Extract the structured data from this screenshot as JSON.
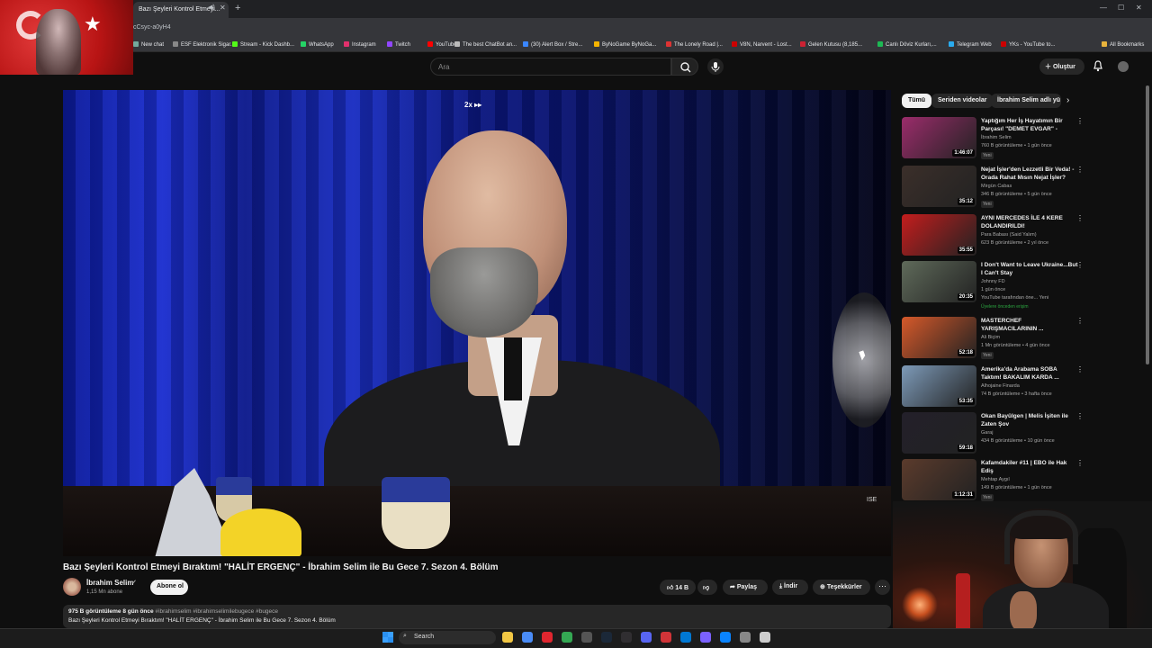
{
  "browser": {
    "active_tab_title": "Bazı Şeyleri Kontrol Etmeyi...",
    "url_fragment": "cCsyc-a0yH4",
    "bookmarks": [
      "New chat",
      "ESF Elektronik Sigar...",
      "Stream - Kick Dashb...",
      "WhatsApp",
      "Instagram",
      "Twitch",
      "YouTube",
      "The best ChatBot an...",
      "(30) Alert Box / Stre...",
      "ByNoGame ByNoGa...",
      "The Lonely Road |...",
      "V8N, Narvent - Lost...",
      "Gelen Kutusu (8,185...",
      "Canlı Döviz Kurları,...",
      "Telegram Web",
      "YKs - YouTube to..."
    ],
    "all_bookmarks_label": "All Bookmarks"
  },
  "youtube_header": {
    "search_placeholder": "Ara",
    "create_label": "Oluştur"
  },
  "video": {
    "speed_badge": "2x ▸▸",
    "watermark": "ISE",
    "title": "Bazı Şeyleri Kontrol Etmeyi Bıraktım! \"HALİT ERGENÇ\" - İbrahim Selim ile Bu Gece 7. Sezon 4. Bölüm",
    "channel": {
      "name": "İbrahim Selim",
      "subscribers": "1,15 Mn abone",
      "subscribe_label": "Abone ol"
    },
    "actions": {
      "likes": "14 B",
      "share": "Paylaş",
      "download": "İndir",
      "thanks": "Teşekkürler"
    },
    "description": {
      "views": "975 B görüntüleme",
      "age": "8 gün önce",
      "hashtags": "#ibrahimselim #ibrahimselimilebugece #bugece",
      "text": "Bazı Şeyleri Kontrol Etmeyi Bıraktım! \"HALİT ERGENÇ\" - İbrahim Selim ile Bu Gece 7. Sezon 4. Bölüm"
    }
  },
  "chips": [
    "Tümü",
    "Seriden videolar",
    "İbrahim Selim adlı yü"
  ],
  "recommendations": [
    {
      "title": "Yaptığım Her İş Hayatımın Bir Parçası! \"DEMET EVGAR\" - İbrahim...",
      "channel": "İbrahim Selim",
      "meta": "760 B görüntüleme • 1 gün önce",
      "tag": "Yeni",
      "duration": "1:46:07",
      "color": "#9b2c6b"
    },
    {
      "title": "Nejat İşler'den Lezzetli Bir Veda! - Orada Rahat Mısın Nejat İşler?",
      "channel": "Mirgün Cabas",
      "meta": "346 B görüntüleme • 5 gün önce",
      "tag": "Yeni",
      "duration": "35:12",
      "color": "#3b2f2a"
    },
    {
      "title": "AYNI MERCEDES İLE 4 KERE DOLANDIRILDI!",
      "channel": "Para Babası (Said Yalım)",
      "meta": "623 B görüntüleme • 2 yıl önce",
      "tag": "",
      "duration": "35:55",
      "color": "#c41d1d"
    },
    {
      "title": "I Don't Want to Leave Ukraine...But I Can't Stay",
      "channel": "Johnny FD",
      "meta": "1 gün önce",
      "extra": "YouTube tarafından öne...   Yeni",
      "members": "Üyelere önceden erişim",
      "tag": "",
      "duration": "20:35",
      "color": "#5f6a5a"
    },
    {
      "title": "MASTERCHEF YARIŞMACILARININ ...",
      "channel": "Ali Biçim",
      "meta": "1 Mn görüntüleme • 4 gün önce",
      "tag": "Yeni",
      "duration": "52:18",
      "color": "#d6592a"
    },
    {
      "title": "Amerika'da Arabama SOBA Taktım! BAKALIM KARDA ...",
      "channel": "Alhojaine Finarda",
      "meta": "74 B görüntüleme • 3 hafta önce",
      "tag": "",
      "duration": "53:35",
      "color": "#7d9ab8"
    },
    {
      "title": "Okan Bayülgen | Melis İşiten ile Zaten Şov",
      "channel": "Garaj",
      "meta": "434 B görüntüleme • 10 gün önce",
      "tag": "",
      "duration": "59:18",
      "color": "#23202a"
    },
    {
      "title": "Kafamdakiler #11 | EBO ile Hak Ediş",
      "channel": "Mehtap Aygıl",
      "meta": "149 B görüntüleme • 1 gün önce",
      "tag": "Yeni",
      "duration": "1:12:31",
      "color": "#5b3b2c"
    }
  ],
  "taskbar": {
    "search_label": "Search"
  }
}
